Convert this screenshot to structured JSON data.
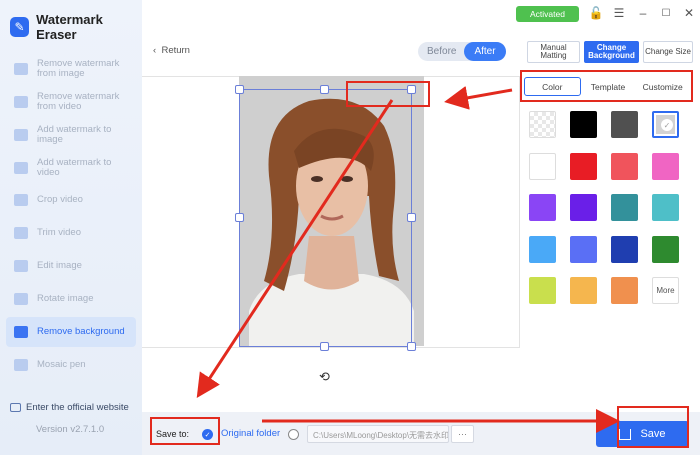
{
  "app": {
    "name": "Watermark Eraser",
    "version": "Version v2.7.1.0",
    "official_link": "Enter the official website"
  },
  "status": {
    "activated": "Activated"
  },
  "sidebar": {
    "items": [
      {
        "label": "Remove watermark from image",
        "active": false
      },
      {
        "label": "Remove watermark from video",
        "active": false
      },
      {
        "label": "Add watermark to image",
        "active": false
      },
      {
        "label": "Add watermark to video",
        "active": false
      },
      {
        "label": "Crop video",
        "active": false
      },
      {
        "label": "Trim video",
        "active": false
      },
      {
        "label": "Edit image",
        "active": false
      },
      {
        "label": "Rotate image",
        "active": false
      },
      {
        "label": "Remove background",
        "active": true
      },
      {
        "label": "Mosaic pen",
        "active": false
      }
    ]
  },
  "editor": {
    "return_label": "Return",
    "toggle": {
      "before": "Before",
      "after": "After",
      "selected": "After"
    }
  },
  "panel": {
    "tabs": [
      "Manual Matting",
      "Change Background",
      "Change Size"
    ],
    "active_tab": "Change Background",
    "sub_tabs": [
      "Color",
      "Template",
      "Customize"
    ],
    "active_sub_tab": "Color",
    "swatches": [
      "transparent",
      "#000000",
      "#505050",
      "#d3d3d3",
      "#ffffff",
      "#e81d25",
      "#f0545c",
      "#f065c3",
      "#8a45f5",
      "#6a1fe8",
      "#33919b",
      "#4ebfc8",
      "#4aa9f7",
      "#5a6ff5",
      "#1f3eb0",
      "#2e8a2f",
      "#c9df4d",
      "#f5b64e",
      "#f0904e"
    ],
    "selected_swatch": "#d3d3d3",
    "more_label": "More"
  },
  "bottom": {
    "save_to_label": "Save to:",
    "original_folder_label": "Original folder",
    "custom_path": "C:\\Users\\MLoong\\Desktop\\无需去水印",
    "browse_label": "···",
    "save_label": "Save"
  }
}
